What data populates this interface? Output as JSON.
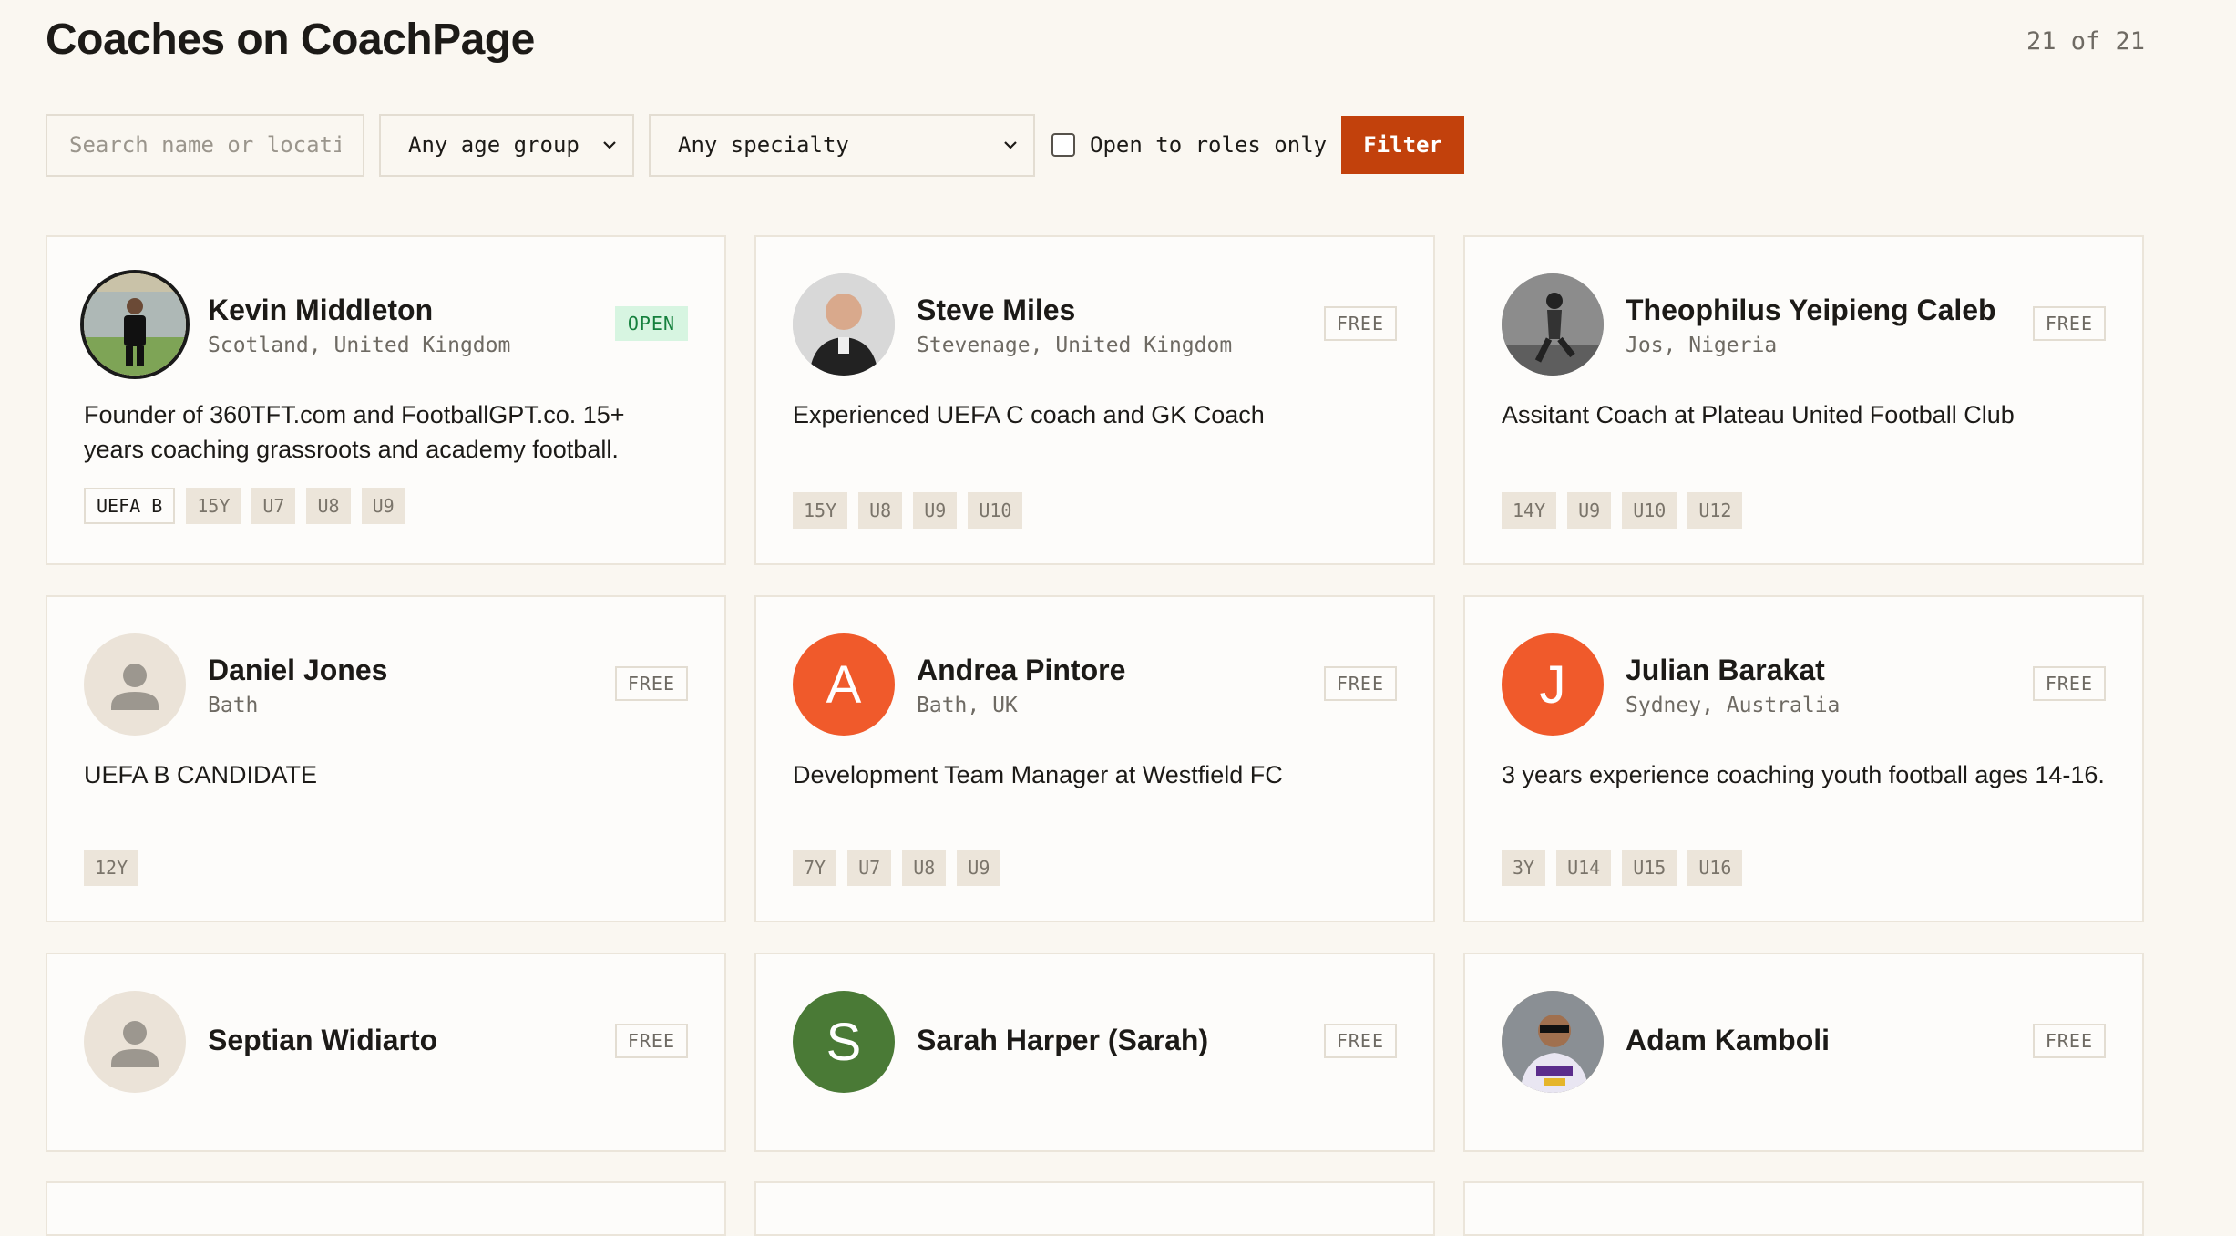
{
  "header": {
    "title": "Coaches on CoachPage",
    "count": "21 of 21"
  },
  "filters": {
    "search_placeholder": "Search name or locati",
    "age_group": "Any age group",
    "specialty": "Any specialty",
    "open_only_label": "Open to roles only",
    "filter_button": "Filter"
  },
  "colors": {
    "accent": "#c2410c",
    "open_badge_bg": "#d7f5e1",
    "avatar_orange": "#f05a2b",
    "avatar_green": "#4a7a36"
  },
  "coaches": [
    {
      "name": "Kevin Middleton",
      "location": "Scotland, United Kingdom",
      "status": "OPEN",
      "bio": "Founder of 360TFT.com and FootballGPT.co. 15+ years coaching grassroots and academy football.",
      "tags": [
        "UEFA B",
        "15Y",
        "U7",
        "U8",
        "U9"
      ],
      "avatar": "photo-coach-field"
    },
    {
      "name": "Steve Miles",
      "location": "Stevenage, United Kingdom",
      "status": "FREE",
      "bio": "Experienced UEFA C coach and GK Coach",
      "tags": [
        "15Y",
        "U8",
        "U9",
        "U10"
      ],
      "avatar": "photo-headshot"
    },
    {
      "name": "Theophilus Yeipieng Caleb",
      "location": "Jos, Nigeria",
      "status": "FREE",
      "bio": "Assitant Coach at Plateau United Football Club",
      "tags": [
        "14Y",
        "U9",
        "U10",
        "U12"
      ],
      "avatar": "photo-player-kick"
    },
    {
      "name": "Daniel Jones",
      "location": "Bath",
      "status": "FREE",
      "bio": "UEFA B CANDIDATE",
      "tags": [
        "12Y"
      ],
      "avatar": "person-placeholder-icon"
    },
    {
      "name": "Andrea Pintore",
      "location": "Bath, UK",
      "status": "FREE",
      "bio": "Development Team Manager at Westfield FC",
      "tags": [
        "7Y",
        "U7",
        "U8",
        "U9"
      ],
      "avatar_letter": "A"
    },
    {
      "name": "Julian Barakat",
      "location": "Sydney, Australia",
      "status": "FREE",
      "bio": "3 years experience coaching youth football ages 14-16.",
      "tags": [
        "3Y",
        "U14",
        "U15",
        "U16"
      ],
      "avatar_letter": "J"
    },
    {
      "name": "Septian Widiarto",
      "status": "FREE",
      "avatar": "person-placeholder-icon"
    },
    {
      "name": "Sarah Harper (Sarah)",
      "status": "FREE",
      "avatar_letter": "S"
    },
    {
      "name": "Adam Kamboli",
      "status": "FREE",
      "avatar": "photo-selfie"
    }
  ]
}
